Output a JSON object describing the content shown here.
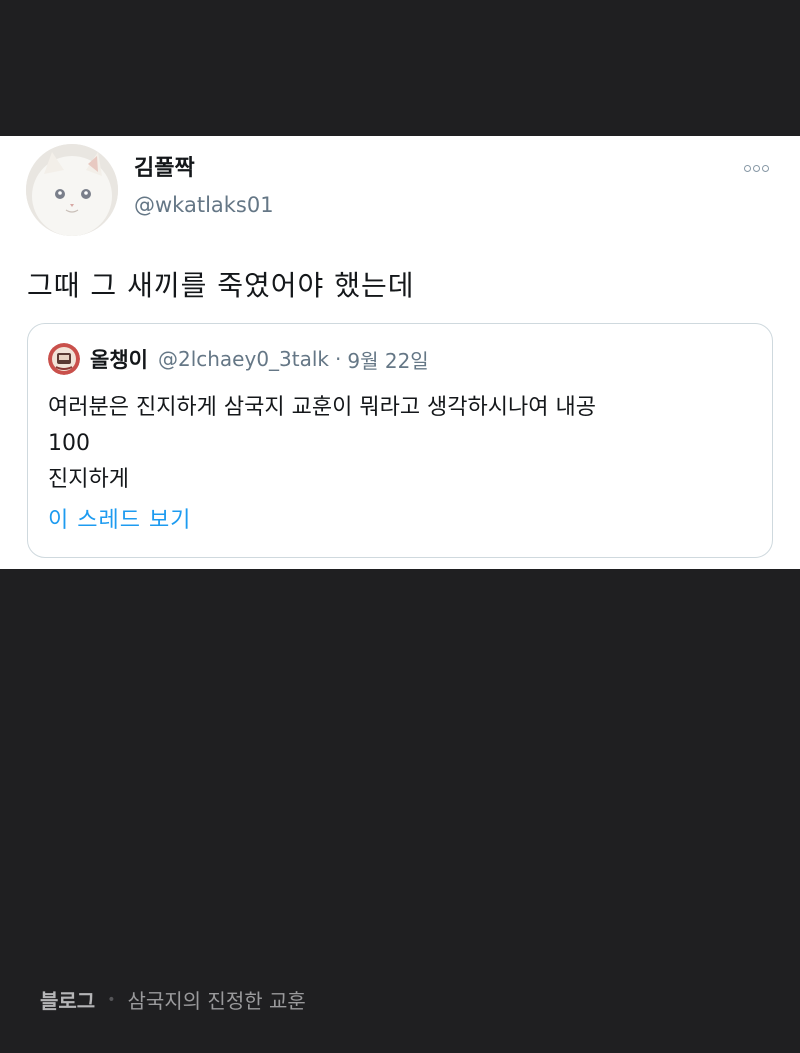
{
  "tweet": {
    "display_name": "김폴짝",
    "handle": "@wkatlaks01",
    "text": "그때 그 새끼를 죽였어야 했는데",
    "more_icon": "more-options-icon",
    "avatar_icon": "white-cat-avatar"
  },
  "quote": {
    "display_name": "올챙이",
    "handle": "@2lchaey0_3talk",
    "separator": "·",
    "date": "9월 22일",
    "lines": [
      "여러분은 진지하게 삼국지 교훈이 뭐라고 생각하시나여 내공",
      "100",
      "진지하게"
    ],
    "thread_link": "이 스레드 보기",
    "avatar_icon": "quote-avatar-icon"
  },
  "footer": {
    "brand": "블로그",
    "separator": "•",
    "title": "삼국지의 진정한 교훈"
  },
  "colors": {
    "background": "#1f1f21",
    "card": "#ffffff",
    "link": "#1d9bf0",
    "secondary_text": "#657786"
  }
}
